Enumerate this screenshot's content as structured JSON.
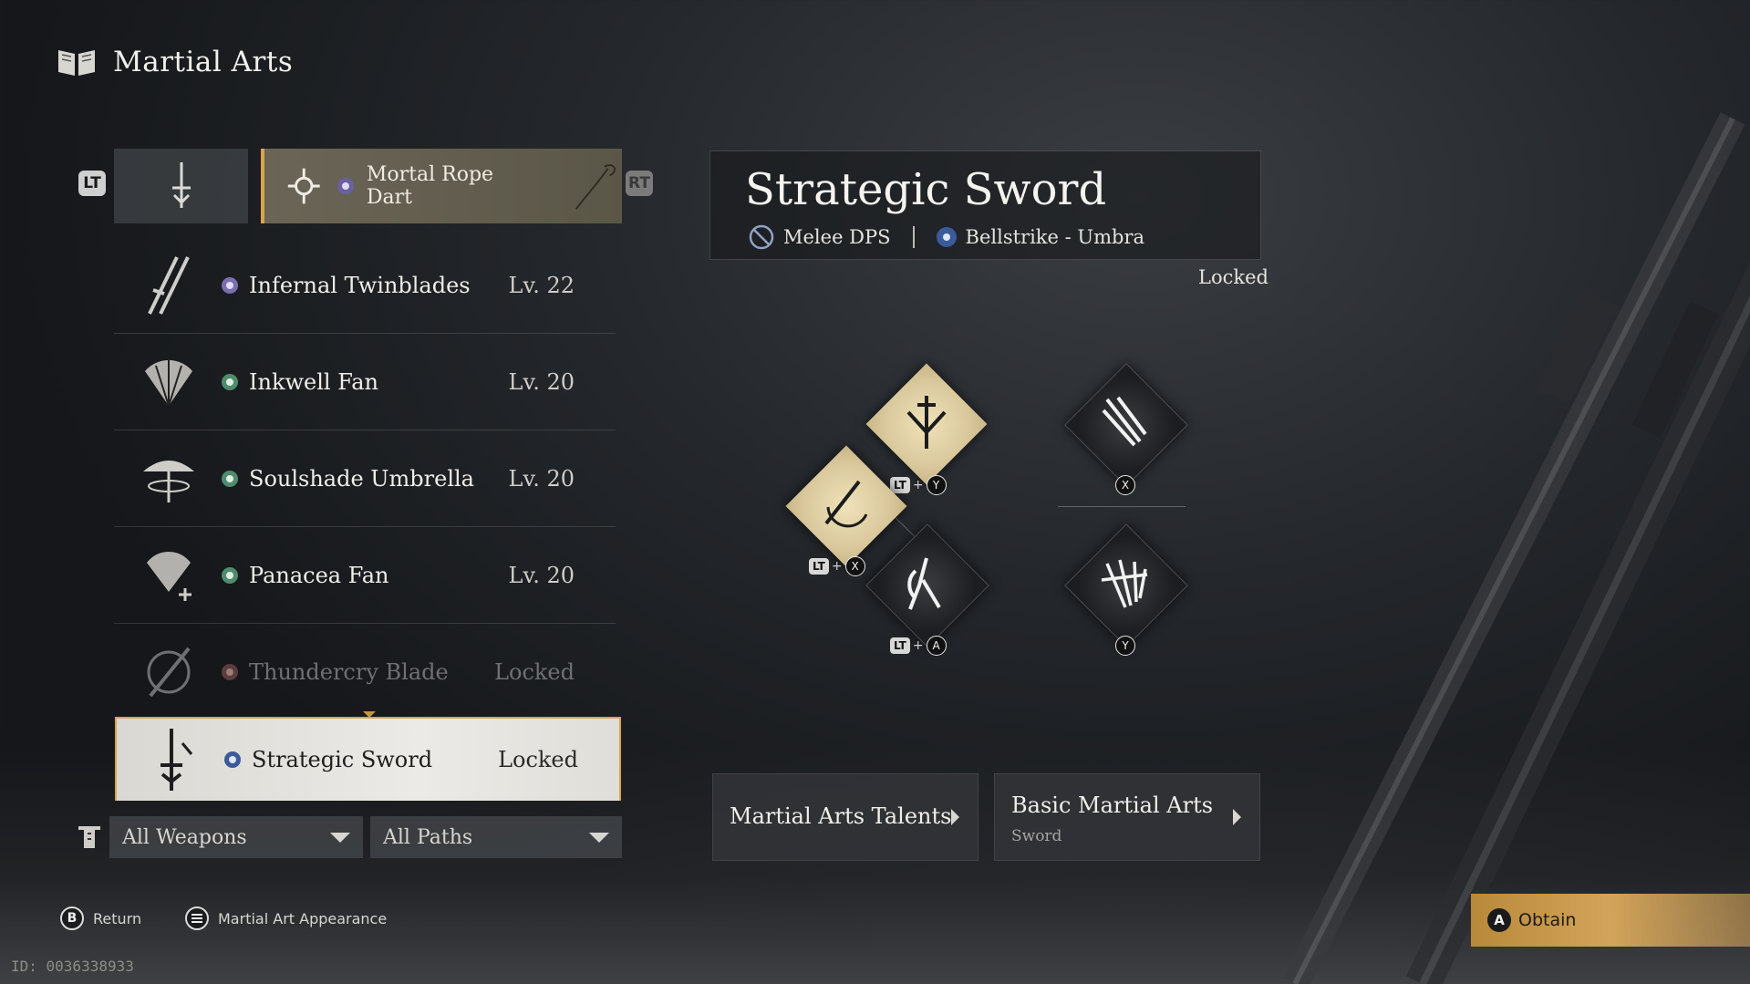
{
  "header": {
    "title": "Martial Arts",
    "icon": "book-icon"
  },
  "bumpers": {
    "left": "LT",
    "right": "RT"
  },
  "top_tabs": {
    "left_icon": "sword-category-icon",
    "selected": {
      "label": "Mortal Rope Dart",
      "icon": "rope-dart-icon"
    }
  },
  "weapons": [
    {
      "name": "Infernal Twinblades",
      "level": "Lv. 22",
      "icon": "twinblades-icon",
      "badge_color": "#7a6fb0"
    },
    {
      "name": "Inkwell Fan",
      "level": "Lv. 20",
      "icon": "fan-icon",
      "badge_color": "#4e8c6c"
    },
    {
      "name": "Soulshade Umbrella",
      "level": "Lv. 20",
      "icon": "umbrella-icon",
      "badge_color": "#4e8c6c"
    },
    {
      "name": "Panacea Fan",
      "level": "Lv. 20",
      "icon": "fan-heal-icon",
      "badge_color": "#4e8c6c"
    },
    {
      "name": "Thundercry Blade",
      "level": "Locked",
      "icon": "blade-icon",
      "badge_color": "#8a4a4a"
    }
  ],
  "selected_weapon": {
    "name": "Strategic Sword",
    "level": "Locked",
    "icon": "strategic-sword-icon",
    "badge_color": "#3a5a9a"
  },
  "filters": {
    "weapons": "All Weapons",
    "paths": "All Paths"
  },
  "detail": {
    "title": "Strategic Sword",
    "role": "Melee DPS",
    "path": "Bellstrike - Umbra",
    "status": "Locked"
  },
  "skills": [
    {
      "id": "top",
      "style": "gold",
      "modifier": "LT",
      "button": "Y"
    },
    {
      "id": "left",
      "style": "gold",
      "modifier": "LT",
      "button": "X"
    },
    {
      "id": "center",
      "style": "dark",
      "modifier": "LT",
      "button": "A"
    },
    {
      "id": "right-top",
      "style": "dark",
      "modifier": "",
      "button": "X"
    },
    {
      "id": "right-bottom",
      "style": "dark",
      "modifier": "",
      "button": "Y"
    }
  ],
  "cards": {
    "talents": {
      "title": "Martial Arts Talents"
    },
    "basic": {
      "title": "Basic Martial Arts",
      "subtitle": "Sword"
    }
  },
  "footer": {
    "return_button": "B",
    "return_label": "Return",
    "appearance_label": "Martial Art Appearance",
    "obtain_button": "A",
    "obtain_label": "Obtain",
    "id_text": "ID: 0036338933"
  },
  "colors": {
    "accent": "#d9a44a",
    "obtain": "#d2a35a"
  }
}
